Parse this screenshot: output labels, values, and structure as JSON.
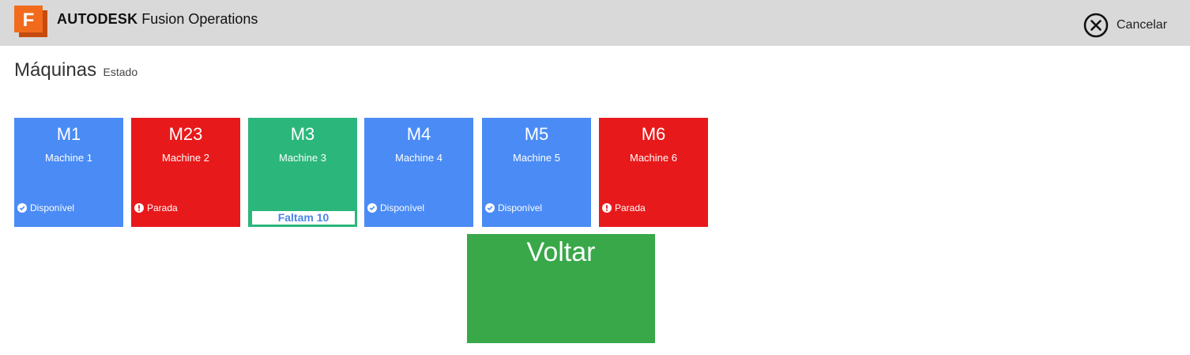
{
  "header": {
    "brand_bold": "AUTODESK",
    "brand_rest": "Fusion Operations",
    "logo_letter": "F",
    "cancel_label": "Cancelar",
    "cancel_icon": "close-circle-icon"
  },
  "page": {
    "title": "Máquinas",
    "subtitle": "Estado"
  },
  "machines": [
    {
      "code": "M1",
      "name": "Machine 1",
      "status": "Disponível",
      "status_icon": "check-circle-icon",
      "color": "#4a8bf5"
    },
    {
      "code": "M23",
      "name": "Machine 2",
      "status": "Parada",
      "status_icon": "alert-circle-icon",
      "color": "#e8191b"
    },
    {
      "code": "M3",
      "name": "Machine 3",
      "remaining": "Faltam 10",
      "color": "#2bb77b"
    },
    {
      "code": "M4",
      "name": "Machine 4",
      "status": "Disponível",
      "status_icon": "check-circle-icon",
      "color": "#4a8bf5"
    },
    {
      "code": "M5",
      "name": "Machine 5",
      "status": "Disponível",
      "status_icon": "check-circle-icon",
      "color": "#4a8bf5"
    },
    {
      "code": "M6",
      "name": "Machine 6",
      "status": "Parada",
      "status_icon": "alert-circle-icon",
      "color": "#e8191b"
    }
  ],
  "back_button": {
    "label": "Voltar",
    "color": "#38a848"
  }
}
